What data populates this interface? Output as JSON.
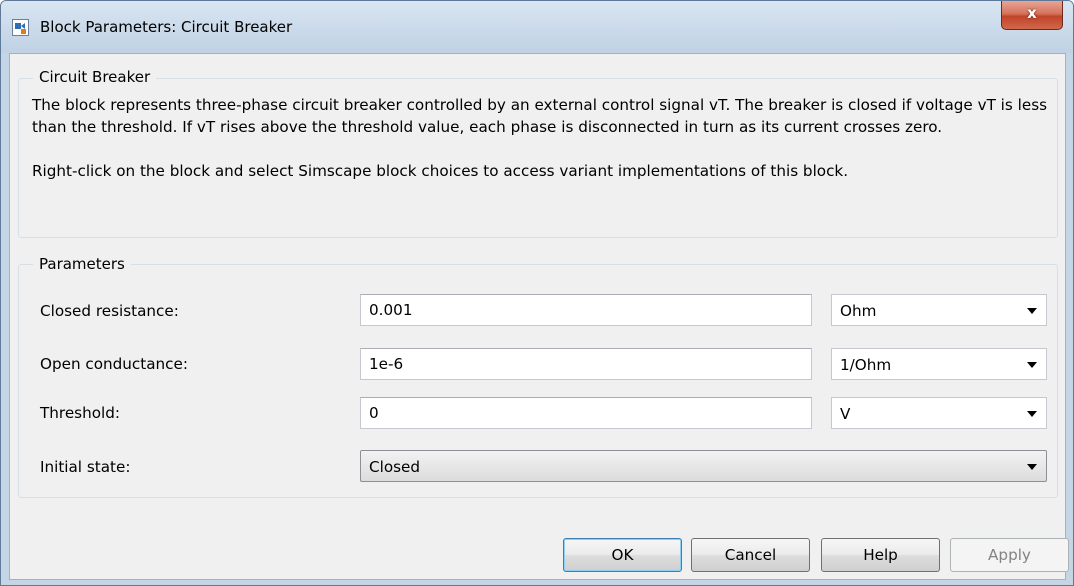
{
  "window": {
    "title": "Block Parameters: Circuit Breaker",
    "close_label": "x",
    "colors": {
      "frame": "#c4d5e6",
      "client": "#f0f0f0",
      "close_button": "#c7503a",
      "default_button_border": "#3c7fb1"
    }
  },
  "description_group": {
    "legend": "Circuit Breaker",
    "paragraph_1": "The block represents three-phase circuit breaker controlled by an external control signal vT. The breaker is closed if voltage vT is less than the threshold. If vT rises above the threshold value, each phase is disconnected in turn as its current crosses zero.",
    "paragraph_2": "Right-click on the block and select Simscape block choices to access variant implementations of this block."
  },
  "parameters": {
    "legend": "Parameters",
    "closed_resistance": {
      "label": "Closed resistance:",
      "value": "0.001",
      "unit": "Ohm"
    },
    "open_conductance": {
      "label": "Open conductance:",
      "value": "1e-6",
      "unit": "1/Ohm"
    },
    "threshold": {
      "label": "Threshold:",
      "value": "0",
      "unit": "V"
    },
    "initial_state": {
      "label": "Initial state:",
      "value": "Closed"
    }
  },
  "buttons": {
    "ok": "OK",
    "cancel": "Cancel",
    "help": "Help",
    "apply": "Apply",
    "apply_enabled": false
  },
  "icons": {
    "app": "simulink-block-icon",
    "close": "close-icon",
    "dropdown": "chevron-down-icon"
  }
}
